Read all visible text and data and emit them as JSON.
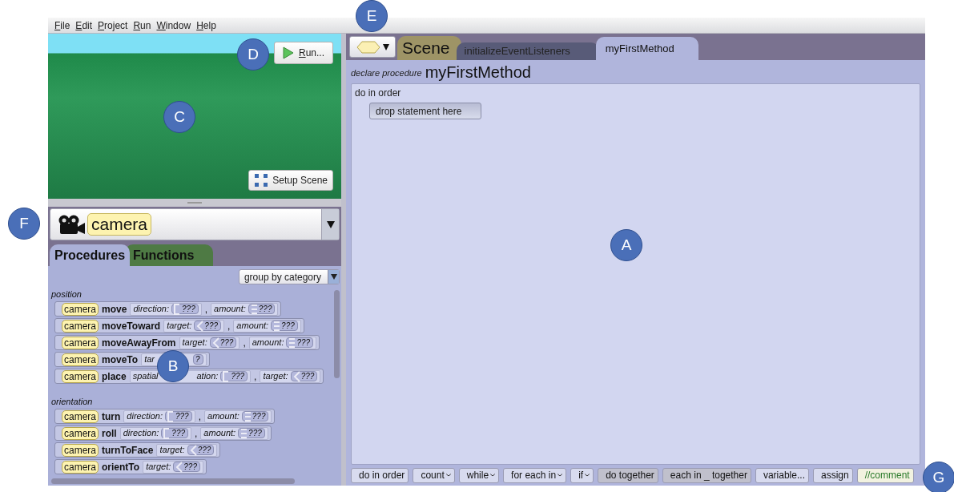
{
  "menu_bar": [
    {
      "label": "File"
    },
    {
      "label": "Edit"
    },
    {
      "label": "Project"
    },
    {
      "label": "Run"
    },
    {
      "label": "Window"
    },
    {
      "label": "Help"
    }
  ],
  "scene_view": {
    "run_button": "Run...",
    "setup_button": "Setup Scene"
  },
  "object_selector": {
    "value": "camera"
  },
  "member_tabs": [
    {
      "label": "Procedures",
      "selected": true
    },
    {
      "label": "Functions",
      "selected": false
    }
  ],
  "group_dropdown": "group by category",
  "categories": [
    {
      "name": "position",
      "procedures": [
        {
          "object": "camera",
          "method": "move",
          "params": [
            {
              "name": "direction:",
              "kind": "direction",
              "value": "???"
            },
            {
              "lead": ",",
              "name": "amount:",
              "kind": "amount",
              "value": "???"
            }
          ]
        },
        {
          "object": "camera",
          "method": "moveToward",
          "params": [
            {
              "name": "target:",
              "kind": "target",
              "value": "???"
            },
            {
              "lead": ",",
              "name": "amount:",
              "kind": "amount",
              "value": "???"
            }
          ]
        },
        {
          "object": "camera",
          "method": "moveAwayFrom",
          "params": [
            {
              "name": "target:",
              "kind": "target",
              "value": "???"
            },
            {
              "lead": ",",
              "name": "amount:",
              "kind": "amount",
              "value": "???"
            }
          ]
        },
        {
          "object": "camera",
          "method": "moveTo",
          "params": [
            {
              "name": "tar",
              "covered": true,
              "kind": "none",
              "value": "?"
            }
          ]
        },
        {
          "object": "camera",
          "method": "place",
          "params": [
            {
              "name": "spatial",
              "covered": true,
              "name_tail": "ation:",
              "kind": "direction",
              "value": "???"
            },
            {
              "lead": ",",
              "name": "target:",
              "kind": "target",
              "value": "???"
            }
          ]
        }
      ]
    },
    {
      "name": "orientation",
      "procedures": [
        {
          "object": "camera",
          "method": "turn",
          "params": [
            {
              "name": "direction:",
              "kind": "direction",
              "value": "???"
            },
            {
              "lead": ",",
              "name": "amount:",
              "kind": "amount",
              "value": "???"
            }
          ]
        },
        {
          "object": "camera",
          "method": "roll",
          "params": [
            {
              "name": "direction:",
              "kind": "direction",
              "value": "???"
            },
            {
              "lead": ",",
              "name": "amount:",
              "kind": "amount",
              "value": "???"
            }
          ]
        },
        {
          "object": "camera",
          "method": "turnToFace",
          "params": [
            {
              "name": "target:",
              "kind": "target",
              "value": "???"
            }
          ]
        },
        {
          "object": "camera",
          "method": "orientTo",
          "params": [
            {
              "name": "target:",
              "kind": "target",
              "value": "???"
            }
          ]
        }
      ]
    }
  ],
  "editor_tabs": [
    {
      "label": "Scene",
      "kind": "scene",
      "selected": false
    },
    {
      "label": "initializeEventListeners",
      "kind": "method",
      "selected": false
    },
    {
      "label": "myFirstMethod",
      "kind": "method",
      "selected": true
    }
  ],
  "declaration": {
    "prefix": "declare procedure",
    "name": "myFirstMethod"
  },
  "body": {
    "block": "do in order",
    "drop_hint": "drop statement here"
  },
  "statement_palette": [
    {
      "label": "do in order",
      "kind": "plain",
      "has_menu": false
    },
    {
      "label": "count",
      "kind": "plain",
      "has_menu": true
    },
    {
      "label": "while",
      "kind": "plain",
      "has_menu": true
    },
    {
      "label": "for each in",
      "kind": "plain",
      "has_menu": true
    },
    {
      "label": "if",
      "kind": "plain",
      "has_menu": true
    },
    {
      "label": "do together",
      "kind": "parallel",
      "has_menu": false
    },
    {
      "label": "each in _ together",
      "kind": "parallel",
      "has_menu": false
    },
    {
      "label": "variable...",
      "kind": "plain",
      "has_menu": false
    },
    {
      "label": "assign",
      "kind": "plain",
      "has_menu": false
    },
    {
      "label": "//comment",
      "kind": "comment",
      "has_menu": false
    }
  ],
  "callouts": [
    {
      "label": "A"
    },
    {
      "label": "B"
    },
    {
      "label": "C"
    },
    {
      "label": "D"
    },
    {
      "label": "E"
    },
    {
      "label": "F"
    },
    {
      "label": "G"
    }
  ]
}
